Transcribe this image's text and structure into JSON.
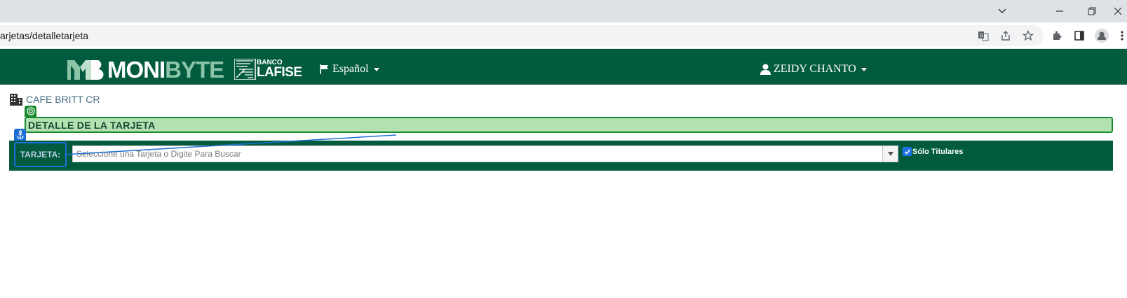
{
  "browser": {
    "url": "arjetas/detalletarjeta",
    "icons": [
      "chevron-down-icon",
      "minimize-icon",
      "restore-icon",
      "close-icon",
      "translate-icon",
      "share-icon",
      "star-icon",
      "extensions-icon",
      "sidepanel-icon",
      "profile-icon",
      "menu-icon"
    ]
  },
  "header": {
    "logo_moni": "MONI",
    "logo_byte": "BYTE",
    "bank_small": "BANCO",
    "bank_name": "LAFISE",
    "language": "Español",
    "user_name": "ZEIDY CHANTO"
  },
  "company": {
    "name": "CAFE BRITT CR"
  },
  "detail": {
    "title": "DETALLE DE LA TARJETA"
  },
  "card_search": {
    "label": "TARJETA:",
    "placeholder": "Seleccione una Tarjeta o Digite Para Buscar",
    "only_holders_label": "Sólo Titulares",
    "only_holders_checked": true
  },
  "colors": {
    "brand_green": "#025b3f",
    "highlight_green": "#b3e1b1",
    "marker_blue": "#1c6fd6"
  }
}
